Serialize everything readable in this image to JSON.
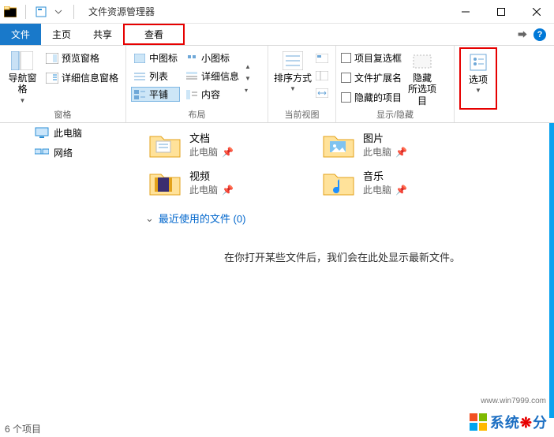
{
  "window": {
    "title": "文件资源管理器"
  },
  "tabs": {
    "file": "文件",
    "home": "主页",
    "share": "共享",
    "view": "查看"
  },
  "ribbon": {
    "panes": {
      "nav": "导航窗格",
      "preview": "预览窗格",
      "details": "详细信息窗格",
      "group": "窗格"
    },
    "layout": {
      "medium_icons": "中图标",
      "small_icons": "小图标",
      "list": "列表",
      "details": "详细信息",
      "tiles": "平铺",
      "content": "内容",
      "group": "布局"
    },
    "current_view": {
      "sort": "排序方式",
      "group": "当前视图"
    },
    "show_hide": {
      "item_checkboxes": "项目复选框",
      "file_ext": "文件扩展名",
      "hidden_items": "隐藏的项目",
      "hide_selected": "隐藏\n所选项目",
      "group": "显示/隐藏"
    },
    "options": "选项"
  },
  "tree": {
    "this_pc": "此电脑",
    "network": "网络"
  },
  "folders": [
    {
      "name": "文档",
      "sub": "此电脑",
      "kind": "docs"
    },
    {
      "name": "图片",
      "sub": "此电脑",
      "kind": "pictures"
    },
    {
      "name": "视频",
      "sub": "此电脑",
      "kind": "videos"
    },
    {
      "name": "音乐",
      "sub": "此电脑",
      "kind": "music"
    }
  ],
  "recent": {
    "header": "最近使用的文件 (0)",
    "empty": "在你打开某些文件后，我们会在此处显示最新文件。"
  },
  "status": {
    "count": "6 个项目"
  },
  "watermark": {
    "brand_a": "系统",
    "brand_b": "分",
    "url": "www.win7999.com"
  }
}
